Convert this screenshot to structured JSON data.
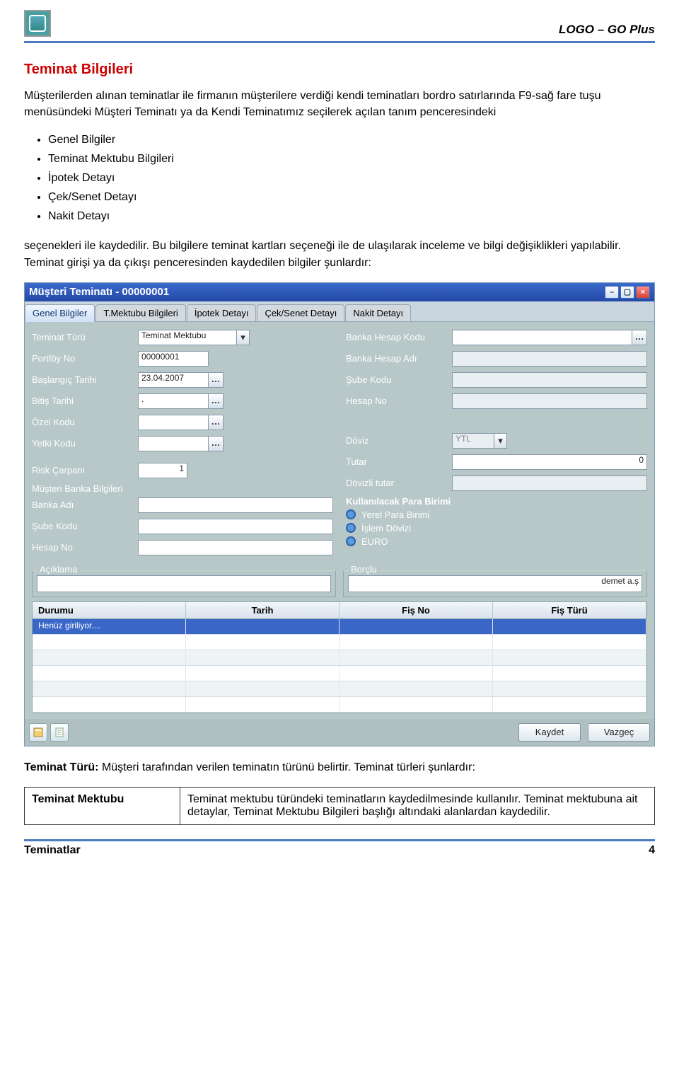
{
  "brand": "LOGO – GO Plus",
  "section_title": "Teminat Bilgileri",
  "para1": "Müşterilerden alınan teminatlar ile firmanın müşterilere verdiği kendi teminatları bordro satırlarında F9-sağ fare tuşu menüsündeki Müşteri Teminatı ya da  Kendi Teminatımız seçilerek açılan tanım penceresindeki",
  "bullets": [
    "Genel Bilgiler",
    "Teminat Mektubu Bilgileri",
    "İpotek Detayı",
    "Çek/Senet Detayı",
    "Nakit Detayı"
  ],
  "para2": "seçenekleri ile kaydedilir. Bu bilgilere teminat kartları seçeneği ile de ulaşılarak inceleme ve bilgi değişiklikleri yapılabilir. Teminat girişi ya da çıkışı penceresinden kaydedilen bilgiler şunlardır:",
  "window": {
    "title": "Müşteri Teminatı - 00000001",
    "tabs": [
      "Genel Bilgiler",
      "T.Mektubu Bilgileri",
      "İpotek Detayı",
      "Çek/Senet Detayı",
      "Nakit Detayı"
    ],
    "left": {
      "teminat_turu_label": "Teminat Türü",
      "teminat_turu_value": "Teminat Mektubu",
      "portfoy_no_label": "Portföy No",
      "portfoy_no_value": "00000001",
      "bas_tarih_label": "Başlangıç Tarihi",
      "bas_tarih_value": "23.04.2007",
      "bit_tarih_label": "Bitiş Tarihi",
      "bit_tarih_value": ".",
      "ozel_kodu_label": "Özel Kodu",
      "yetki_kodu_label": "Yetki Kodu",
      "risk_carpani_label": "Risk Çarpanı",
      "risk_carpani_value": "1",
      "musteri_banka_section": "Müşteri Banka Bilgileri",
      "banka_adi_label": "Banka Adı",
      "sube_kodu_label": "Şube Kodu",
      "hesap_no_label": "Hesap No"
    },
    "right": {
      "banka_hesap_kodu_label": "Banka Hesap Kodu",
      "banka_hesap_adi_label": "Banka Hesap Adı",
      "sube_kodu_label": "Şube Kodu",
      "hesap_no_label": "Hesap No",
      "doviz_label": "Döviz",
      "doviz_value": "YTL",
      "tutar_label": "Tutar",
      "tutar_value": "0",
      "dovizli_tutar_label": "Dövizli tutar",
      "kpb_section": "Kullanılacak Para Birimi",
      "radios": [
        "Yerel Para Birimi",
        "İşlem Dövizi",
        "EURO"
      ]
    },
    "aciklama_label": "Açıklama",
    "borclu_label": "Borçlu",
    "borclu_value": "demet a.ş",
    "grid_headers": [
      "Durumu",
      "Tarih",
      "Fiş No",
      "Fiş Türü"
    ],
    "grid_first": "Henüz giriliyor....",
    "kaydet": "Kaydet",
    "vazgec": "Vazgeç"
  },
  "after1": "Teminat Türü: Müşteri tarafından verilen teminatın türünü belirtir. Teminat türleri şunlardır:",
  "after1_bold": "Teminat Türü:",
  "deftable": {
    "k": "Teminat Mektubu",
    "v": "Teminat mektubu türündeki teminatların kaydedilmesinde kullanılır. Teminat mektubuna ait detaylar, Teminat Mektubu Bilgileri başlığı altındaki alanlardan kaydedilir."
  },
  "footer_left": "Teminatlar",
  "footer_right": "4"
}
